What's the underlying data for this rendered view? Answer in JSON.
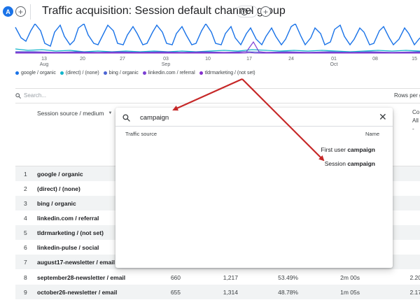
{
  "header": {
    "avatar_letter": "A",
    "title": "Traffic acquisition: Session default channel group"
  },
  "chart": {
    "x_ticks": [
      {
        "day": "13",
        "month": "Aug"
      },
      {
        "day": "20",
        "month": ""
      },
      {
        "day": "27",
        "month": ""
      },
      {
        "day": "03",
        "month": "Sep"
      },
      {
        "day": "10",
        "month": ""
      },
      {
        "day": "17",
        "month": ""
      },
      {
        "day": "24",
        "month": ""
      },
      {
        "day": "01",
        "month": "Oct"
      },
      {
        "day": "08",
        "month": ""
      },
      {
        "day": "15",
        "month": ""
      }
    ],
    "legend": [
      {
        "label": "google / organic",
        "color": "#1a73e8"
      },
      {
        "label": "(direct) / (none)",
        "color": "#12b5cb"
      },
      {
        "label": "bing / organic",
        "color": "#4c64d4"
      },
      {
        "label": "linkedin.com / referral",
        "color": "#7b3fd4"
      },
      {
        "label": "tldrmarketing / (not set)",
        "color": "#8430ce"
      }
    ]
  },
  "table": {
    "search_placeholder": "Search...",
    "rows_per_page_label": "Rows per g",
    "column_header": "Session source / medium",
    "col_fragment_1": "Co",
    "col_fragment_2": "All -",
    "rows": [
      {
        "index": "1",
        "source": "google / organic",
        "c1": "",
        "c2": "",
        "c3": "",
        "c4": "",
        "c5": ""
      },
      {
        "index": "2",
        "source": "(direct) / (none)",
        "c1": "",
        "c2": "",
        "c3": "",
        "c4": "",
        "c5": ""
      },
      {
        "index": "3",
        "source": "bing / organic",
        "c1": "",
        "c2": "",
        "c3": "",
        "c4": "",
        "c5": ""
      },
      {
        "index": "4",
        "source": "linkedin.com / referral",
        "c1": "",
        "c2": "",
        "c3": "",
        "c4": "",
        "c5": ""
      },
      {
        "index": "5",
        "source": "tldrmarketing / (not set)",
        "c1": "",
        "c2": "",
        "c3": "",
        "c4": "",
        "c5": ""
      },
      {
        "index": "6",
        "source": "linkedin-pulse / social",
        "c1": "",
        "c2": "",
        "c3": "",
        "c4": "",
        "c5": ""
      },
      {
        "index": "7",
        "source": "august17-newsletter / email",
        "c1": "",
        "c2": "",
        "c3": "",
        "c4": "",
        "c5": ""
      },
      {
        "index": "8",
        "source": "september28-newsletter / email",
        "c1": "660",
        "c2": "1,217",
        "c3": "53.49%",
        "c4": "2m 00s",
        "c5": "2.20"
      },
      {
        "index": "9",
        "source": "october26-newsletter / email",
        "c1": "655",
        "c2": "1,314",
        "c3": "48.78%",
        "c4": "1m 05s",
        "c5": "2.17"
      }
    ]
  },
  "dimension_picker": {
    "query": "campaign",
    "group_label": "Traffic source",
    "column_label": "Name",
    "options": [
      {
        "prefix": "First user ",
        "match": "campaign"
      },
      {
        "prefix": "Session ",
        "match": "campaign"
      }
    ]
  },
  "colors": {
    "accent": "#1a73e8",
    "annotation_arrow": "#c62828"
  }
}
